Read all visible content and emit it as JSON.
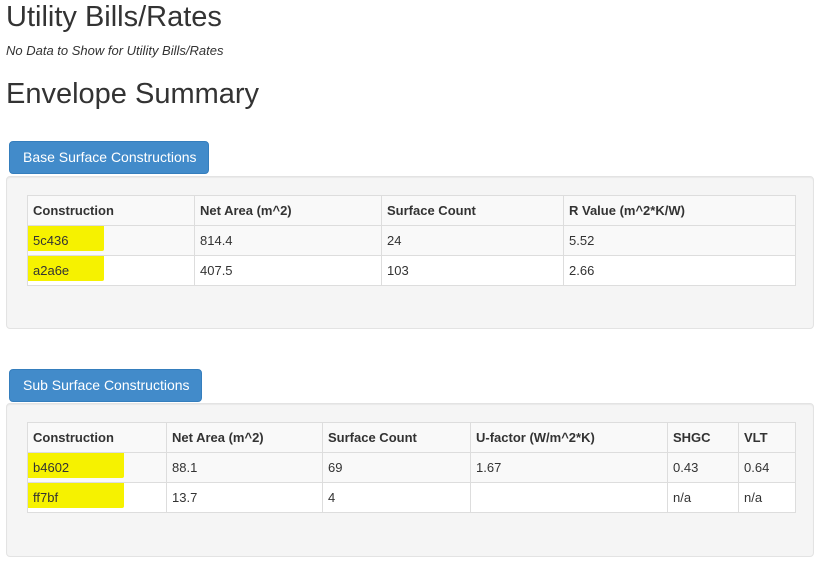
{
  "utility": {
    "title": "Utility Bills/Rates",
    "note": "No Data to Show for Utility Bills/Rates"
  },
  "envelope": {
    "title": "Envelope Summary"
  },
  "base": {
    "button_label": "Base Surface Constructions",
    "columns": [
      "Construction",
      "Net Area (m^2)",
      "Surface Count",
      "R Value (m^2*K/W)"
    ],
    "rows": [
      [
        "5c436",
        "814.4",
        "24",
        "5.52"
      ],
      [
        "a2a6e",
        "407.5",
        "103",
        "2.66"
      ]
    ]
  },
  "sub": {
    "button_label": "Sub Surface Constructions",
    "columns": [
      "Construction",
      "Net Area (m^2)",
      "Surface Count",
      "U-factor (W/m^2*K)",
      "SHGC",
      "VLT"
    ],
    "rows": [
      [
        "b4602",
        "88.1",
        "69",
        "1.67",
        "0.43",
        "0.64"
      ],
      [
        "ff7bf",
        "13.7",
        "4",
        "",
        "n/a",
        "n/a"
      ]
    ]
  },
  "colors": {
    "button_bg": "#428bca",
    "highlight": "#f6f200",
    "well_bg": "#f5f5f5"
  }
}
